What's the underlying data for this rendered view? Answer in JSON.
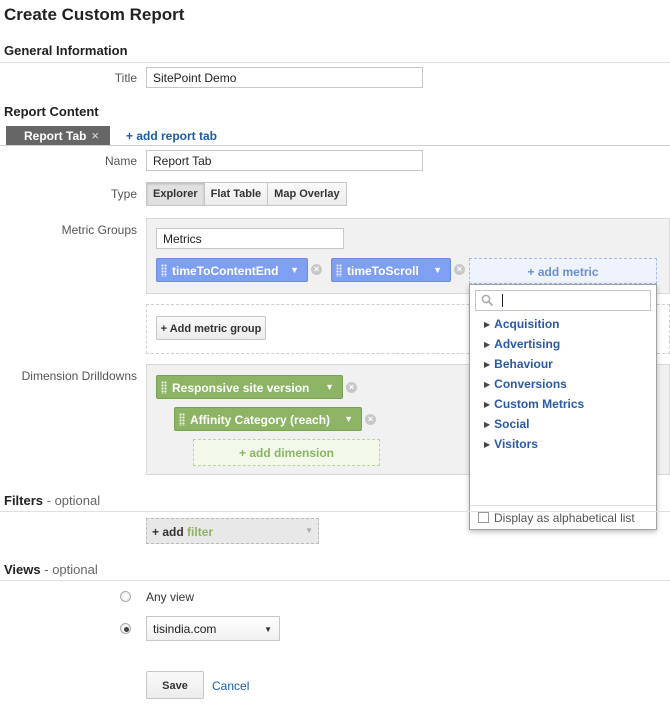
{
  "page": {
    "title": "Create Custom Report"
  },
  "general": {
    "heading": "General Information",
    "title_label": "Title",
    "title_value": "SitePoint Demo"
  },
  "content": {
    "heading": "Report Content",
    "tab_label": "Report Tab",
    "tab_close": "×",
    "add_tab": "+ add report tab",
    "name_label": "Name",
    "name_value": "Report Tab",
    "type_label": "Type",
    "types": [
      "Explorer",
      "Flat Table",
      "Map Overlay"
    ],
    "metric_groups_label": "Metric Groups",
    "metric_group_name": "Metrics",
    "metrics": [
      "timeToContentEnd",
      "timeToScroll"
    ],
    "add_metric": "+ add metric",
    "add_metric_group": "+ Add metric group",
    "dimension_label": "Dimension Drilldowns",
    "dimensions": [
      "Responsive site version",
      "Affinity Category (reach)"
    ],
    "add_dimension": "+ add dimension"
  },
  "metric_dropdown": {
    "categories": [
      "Acquisition",
      "Advertising",
      "Behaviour",
      "Conversions",
      "Custom Metrics",
      "Social",
      "Visitors"
    ],
    "alpha_label": "Display as alphabetical list"
  },
  "filters": {
    "heading": "Filters",
    "optional": "- optional",
    "add_prefix": "+ add",
    "add_word": "filter"
  },
  "views": {
    "heading": "Views",
    "optional": "- optional",
    "any_view": "Any view",
    "selected_view": "tisindia.com"
  },
  "actions": {
    "save": "Save",
    "cancel": "Cancel"
  },
  "colors": {
    "metric_chip": "#7f9ff2",
    "dimension_chip": "#8db464",
    "link": "#1a5da6"
  }
}
